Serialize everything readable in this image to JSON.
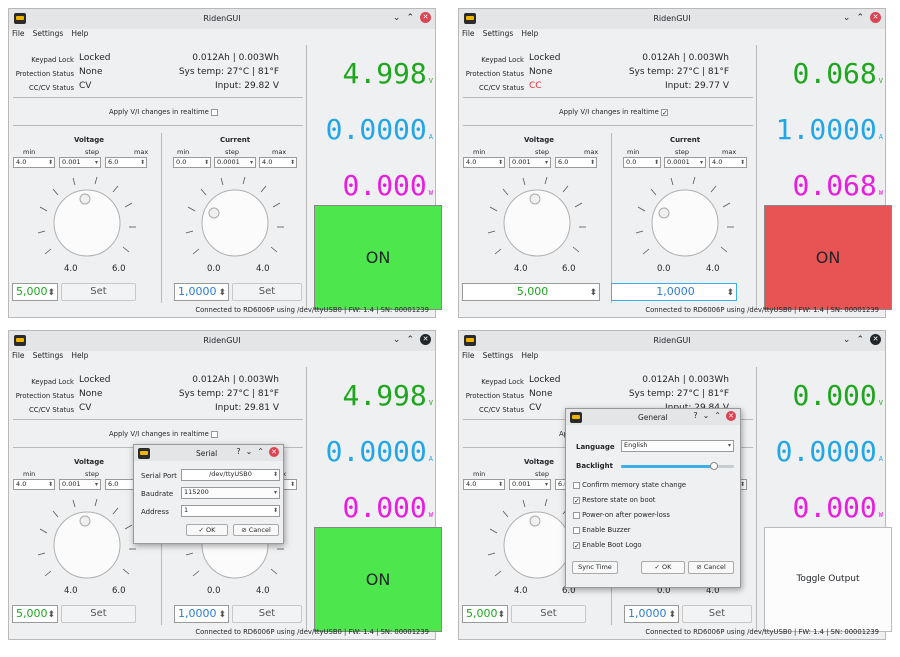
{
  "app": {
    "title": "RidenGUI",
    "menu": [
      "File",
      "Settings",
      "Help"
    ],
    "labels": {
      "keypad_lock": "Keypad Lock",
      "protection_status": "Protection Status",
      "cccv_status": "CC/CV Status",
      "apply_realtime": "Apply V/I changes in realtime",
      "voltage": "Voltage",
      "current": "Current",
      "min": "min",
      "step": "step",
      "max": "max",
      "set": "Set"
    },
    "colors": {
      "voltage": "#1fa61f",
      "current": "#22a6e8",
      "power": "#e81de0",
      "cc": "#e8323c",
      "on_green": "#4de64d",
      "on_red": "#e85353"
    }
  },
  "windows": [
    {
      "keypad_lock": "Locked",
      "protection": "None",
      "cccv": "CV",
      "energy": "0.012Ah | 0.003Wh",
      "temp": "Sys temp: 27°C | 81°F",
      "input": "Input: 29.82 V",
      "realtime_checked": "",
      "v_min": "4.0",
      "v_step": "0.001",
      "v_max": "6.0",
      "i_min": "0.0",
      "i_step": "0.0001",
      "i_max": "4.0",
      "v_knob_min": "4.0",
      "v_knob_max": "6.0",
      "i_knob_min": "0.0",
      "i_knob_max": "4.0",
      "v_set": "5,000",
      "i_set": "1,0000",
      "disp_v": "4.998",
      "disp_i": "0.0000",
      "disp_p": "0.000",
      "unit_v": "V",
      "unit_i": "A",
      "unit_p": "W",
      "output_button": "ON",
      "output_color": "#4de64d",
      "status": "Connected to RD6006P using /dev/ttyUSB0 | FW: 1.4 | SN: 00001239"
    },
    {
      "keypad_lock": "Locked",
      "protection": "None",
      "cccv": "CC",
      "energy": "0.012Ah | 0.003Wh",
      "temp": "Sys temp: 27°C | 81°F",
      "input": "Input: 29.77 V",
      "realtime_checked": "✓",
      "v_min": "4.0",
      "v_step": "0.001",
      "v_max": "6.0",
      "i_min": "0.0",
      "i_step": "0.0001",
      "i_max": "4.0",
      "v_knob_min": "4.0",
      "v_knob_max": "6.0",
      "i_knob_min": "0.0",
      "i_knob_max": "4.0",
      "v_set": "5,000",
      "i_set": "1,0000",
      "disp_v": "0.068",
      "disp_i": "1.0000",
      "disp_p": "0.068",
      "unit_v": "V",
      "unit_i": "A",
      "unit_p": "W",
      "output_button": "ON",
      "output_color": "#e85353",
      "status": "Connected to RD6006P using /dev/ttyUSB0 | FW: 1.4 | SN: 00001239"
    },
    {
      "keypad_lock": "Locked",
      "protection": "None",
      "cccv": "CV",
      "energy": "0.012Ah | 0.003Wh",
      "temp": "Sys temp: 27°C | 81°F",
      "input": "Input: 29.81 V",
      "realtime_checked": "",
      "v_min": "4.0",
      "v_step": "0.001",
      "v_max": "6.0",
      "i_min": "0.0",
      "i_step": "0.0001",
      "i_max": "4.0",
      "v_knob_min": "4.0",
      "v_knob_max": "6.0",
      "i_knob_min": "0.0",
      "i_knob_max": "4.0",
      "v_set": "5,000",
      "i_set": "1,0000",
      "disp_v": "4.998",
      "disp_i": "0.0000",
      "disp_p": "0.000",
      "unit_v": "V",
      "unit_i": "A",
      "unit_p": "W",
      "output_button": "ON",
      "output_color": "#4de64d",
      "status": "Connected to RD6006P using /dev/ttyUSB0 | FW: 1.4 | SN: 00001239"
    },
    {
      "keypad_lock": "Locked",
      "protection": "None",
      "cccv": "CV",
      "energy": "0.012Ah | 0.003Wh",
      "temp": "Sys temp: 27°C | 81°F",
      "input": "Input: 29.84 V",
      "realtime_checked": "",
      "v_min": "4.0",
      "v_step": "0.001",
      "v_max": "6.0",
      "i_min": "0.0",
      "i_step": "0.0001",
      "i_max": "4.0",
      "v_knob_min": "4.0",
      "v_knob_max": "6.0",
      "i_knob_min": "0.0",
      "i_knob_max": "4.0",
      "v_set": "5,000",
      "i_set": "1,0000",
      "disp_v": "0.000",
      "disp_i": "0.0000",
      "disp_p": "0.000",
      "unit_v": "V",
      "unit_i": "A",
      "unit_p": "W",
      "output_button": "Toggle Output",
      "output_color": "#ffffff",
      "status": "Connected to RD6006P using /dev/ttyUSB0 | FW: 1.4 | SN: 00001239"
    }
  ],
  "serial_dialog": {
    "title": "Serial",
    "port_label": "Serial Port",
    "port_value": "/dev/ttyUSB0",
    "baud_label": "Baudrate",
    "baud_value": "115200",
    "addr_label": "Address",
    "addr_value": "1",
    "ok": "✓ OK",
    "cancel": "⊘ Cancel"
  },
  "general_dialog": {
    "title": "General",
    "language_label": "Language",
    "language_value": "English",
    "backlight_label": "Backlight",
    "backlight_level": 0.82,
    "options": [
      {
        "label": "Confirm memory state change",
        "checked": ""
      },
      {
        "label": "Restore state on boot",
        "checked": "✓"
      },
      {
        "label": "Power-on after power-loss",
        "checked": ""
      },
      {
        "label": "Enable Buzzer",
        "checked": ""
      },
      {
        "label": "Enable Boot Logo",
        "checked": "✓"
      }
    ],
    "sync_time": "Sync Time",
    "ok": "✓ OK",
    "cancel": "⊘ Cancel"
  }
}
